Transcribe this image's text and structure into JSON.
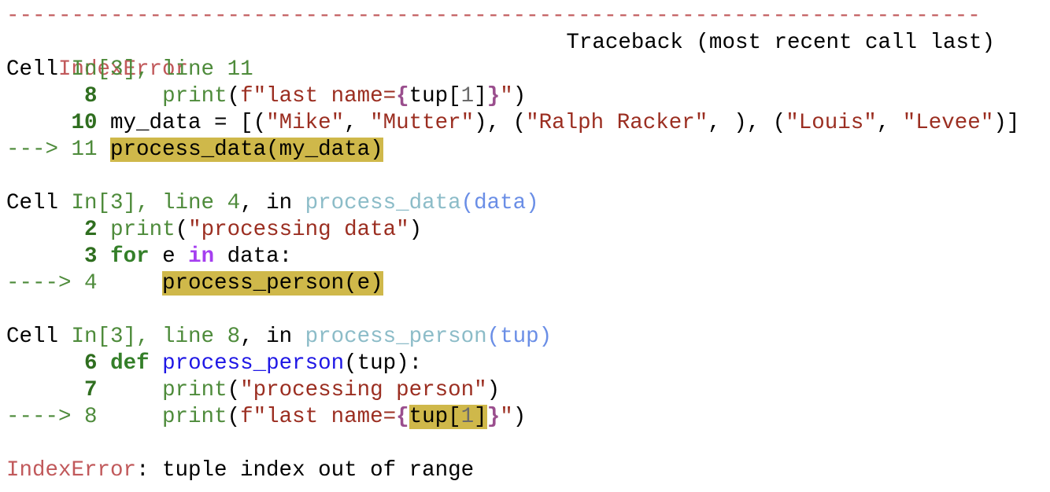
{
  "traceback": {
    "separator": "---------------------------------------------------------------------------",
    "error_type": "IndexError",
    "title": "Traceback (most recent call last)",
    "frames": [
      {
        "cell": "Cell",
        "in_label": "In[3], line 11",
        "lines": [
          {
            "no": "8",
            "code": "    print(f\"last name={tup[1]}\")"
          },
          {
            "no": "10",
            "code": "my_data = [(\"Mike\", \"Mutter\"), (\"Ralph Racker\", ), (\"Louis\", \"Levee\")]"
          },
          {
            "arrow": "---> 11",
            "code": "process_data(my_data)"
          }
        ]
      },
      {
        "cell": "Cell",
        "in_label": "In[3], line 4",
        "in_word": ", in",
        "func": "process_data",
        "args": "(data)",
        "lines": [
          {
            "no": "2",
            "code": "print(\"processing data\")"
          },
          {
            "no": "3",
            "code": "for e in data:"
          },
          {
            "arrow": "----> 4",
            "code": "process_person(e)"
          }
        ]
      },
      {
        "cell": "Cell",
        "in_label": "In[3], line 8",
        "in_word": ", in",
        "func": "process_person",
        "args": "(tup)",
        "lines": [
          {
            "no": "6",
            "code": "def process_person(tup):"
          },
          {
            "no": "7",
            "code": "    print(\"processing person\")"
          },
          {
            "arrow": "----> 8",
            "code": "    print(f\"last name={tup[1]}\")"
          }
        ]
      }
    ],
    "final_error": {
      "type": "IndexError",
      "message": ": tuple index out of range"
    }
  }
}
